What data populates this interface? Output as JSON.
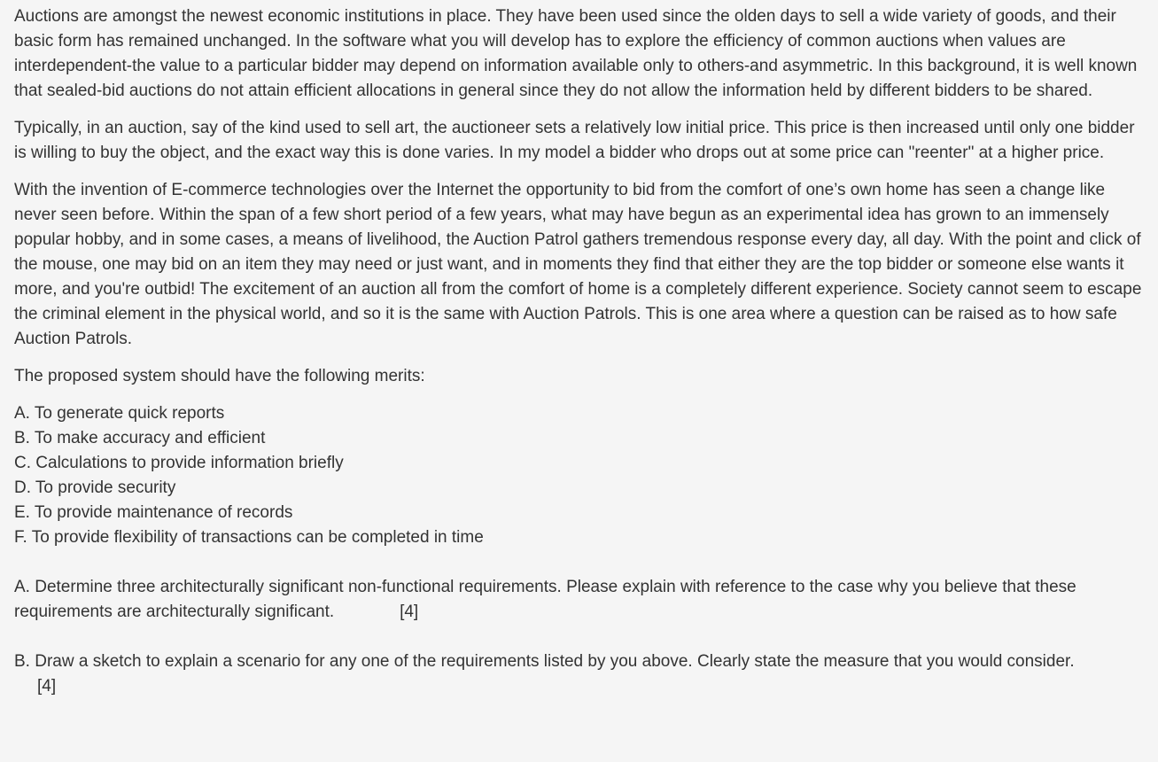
{
  "paragraphs": [
    "Auctions are amongst the newest economic institutions in place. They have been used since the olden days to sell a wide variety of goods, and their basic form has remained unchanged. In the software what you will develop has to explore the efficiency of common auctions when values are interdependent-the value to a particular bidder may depend on information available only to others-and asymmetric. In this background, it is well known that sealed-bid auctions do not attain efficient allocations in general since they do not allow the information held by different bidders to be shared.",
    "Typically, in an auction, say of the kind used to sell art, the auctioneer sets a relatively low initial price. This price is then increased until only one bidder is willing to buy the object, and the exact way this is done varies. In my model a bidder who drops out at some price can \"reenter\" at a higher price.",
    "With the invention of E-commerce technologies over the Internet the opportunity to bid from the comfort of one’s own home has seen a change like never seen before. Within the span of a few short period of a few years, what may have begun as an experimental idea has grown to an immensely popular hobby, and in some cases, a means of livelihood, the Auction Patrol gathers tremendous response every day, all day. With the point and click of the mouse, one may bid on an item they may need or just want, and in moments they find that either they are the top bidder or someone else wants it more, and you're outbid! The excitement of an auction all from the comfort of home is a completely different experience. Society cannot seem to escape the criminal element in the physical world, and so it is the same with Auction Patrols. This is one area where a question can be raised as to how safe Auction Patrols."
  ],
  "merits": {
    "intro": "The proposed system should have the following merits:",
    "items": [
      "A. To generate quick reports",
      "B. To make accuracy and efficient",
      "C. Calculations to provide information briefly",
      "D. To provide security",
      "E. To provide maintenance of records",
      "F. To provide flexibility of transactions can be completed in time"
    ]
  },
  "questions": {
    "a": {
      "text": "A. Determine three architecturally significant non-functional requirements. Please explain with reference to the case why you believe that these requirements are architecturally significant.",
      "marks": "[4]"
    },
    "b": {
      "text": "B. Draw a sketch to explain a scenario for any one of the requirements listed by you above. Clearly state the measure that you would consider.",
      "marks": "[4]"
    }
  }
}
